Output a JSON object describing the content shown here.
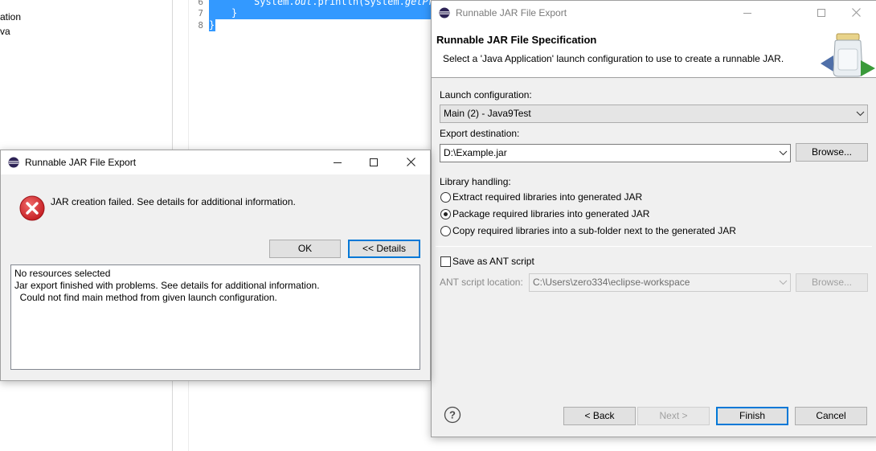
{
  "explorer": {
    "items": [
      "ation",
      "va"
    ]
  },
  "editor": {
    "line_numbers": [
      "6",
      "7",
      "8"
    ],
    "line6_prefix": "System.",
    "line6_field": "out",
    "line6_rest": ".println(System.",
    "line6_method": "getPro",
    "line7": "}",
    "line8": "}"
  },
  "error_dialog": {
    "title": "Runnable JAR File Export",
    "message": "JAR creation failed. See details for additional information.",
    "ok_label": "OK",
    "details_label": "<< Details",
    "details_lines": [
      "No resources selected",
      "Jar export finished with problems. See details for additional information.",
      "  Could not find main method from given launch configuration."
    ]
  },
  "wizard": {
    "title": "Runnable JAR File Export",
    "header_title": "Runnable JAR File Specification",
    "header_description": "Select a 'Java Application' launch configuration to use to create a runnable JAR.",
    "launch_config_label": "Launch configuration:",
    "launch_config_value": "Main (2) - Java9Test",
    "export_dest_label": "Export destination:",
    "export_dest_value": "D:\\Example.jar",
    "browse_label": "Browse...",
    "library_label": "Library handling:",
    "library_options": [
      "Extract required libraries into generated JAR",
      "Package required libraries into generated JAR",
      "Copy required libraries into a sub-folder next to the generated JAR"
    ],
    "library_selected_index": 1,
    "save_ant_label": "Save as ANT script",
    "save_ant_checked": false,
    "ant_location_label": "ANT script location:",
    "ant_location_value": "C:\\Users\\zero334\\eclipse-workspace",
    "ant_browse_label": "Browse...",
    "back_label": "< Back",
    "next_label": "Next >",
    "finish_label": "Finish",
    "cancel_label": "Cancel"
  },
  "colors": {
    "selection": "#3399ff",
    "error_red": "#d7262b",
    "default_button_border": "#0078d7"
  }
}
